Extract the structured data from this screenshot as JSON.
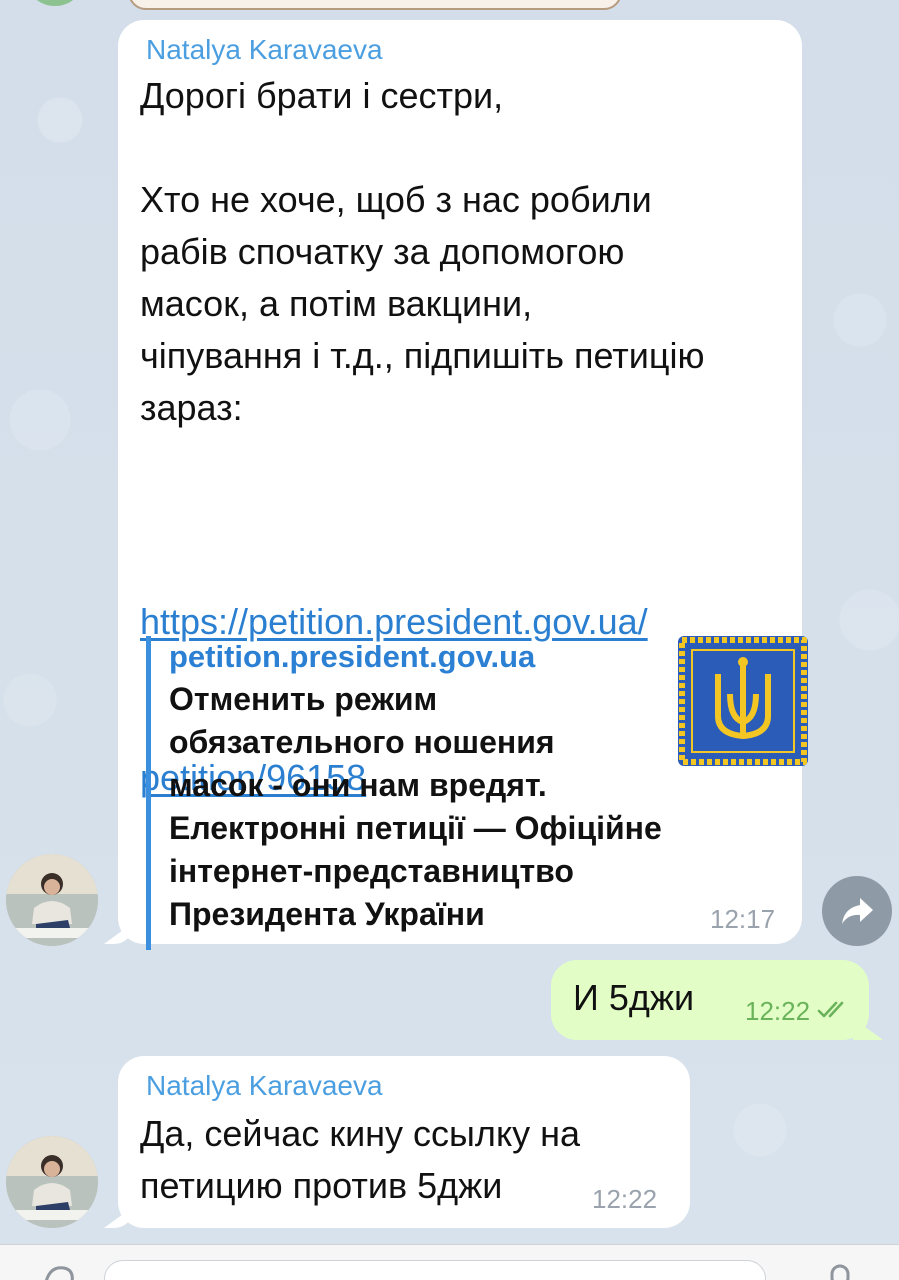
{
  "chat": {
    "messages": [
      {
        "sender": "Natalya Karavaeva",
        "text": "Дорогі брати і сестри,\n\nХто не хоче, щоб з нас робили\nрабів спочатку за допомогою\nмасок, а потім вакцини,\nчіпування і т.д., підпишіть петицію\nзараз:",
        "link_line1": "https://petition.president.gov.ua/",
        "link_line2": "petition/96158",
        "preview": {
          "site": "petition.president.gov.ua",
          "description": "Отменить режим\nобязательного ношения\nмасок - они нам вредят.\nЕлектронні петиції — Офіційне\nінтернет-представництво\nПрезидента України"
        },
        "time": "12:17"
      },
      {
        "text": "И 5джи",
        "time": "12:22",
        "status": "read"
      },
      {
        "sender": "Natalya Karavaeva",
        "text": "Да, сейчас кину ссылку на\nпетицию против 5джи",
        "time": "12:22"
      }
    ]
  },
  "colors": {
    "accent": "#3a8fdf",
    "sender_name": "#4b9fe0",
    "outgoing_bubble": "#e2fec6",
    "flag_blue": "#2a5cb8",
    "trident_gold": "#f3c623"
  },
  "icons": {
    "forward": "forward-arrow-icon",
    "read_status": "double-check-icon"
  }
}
